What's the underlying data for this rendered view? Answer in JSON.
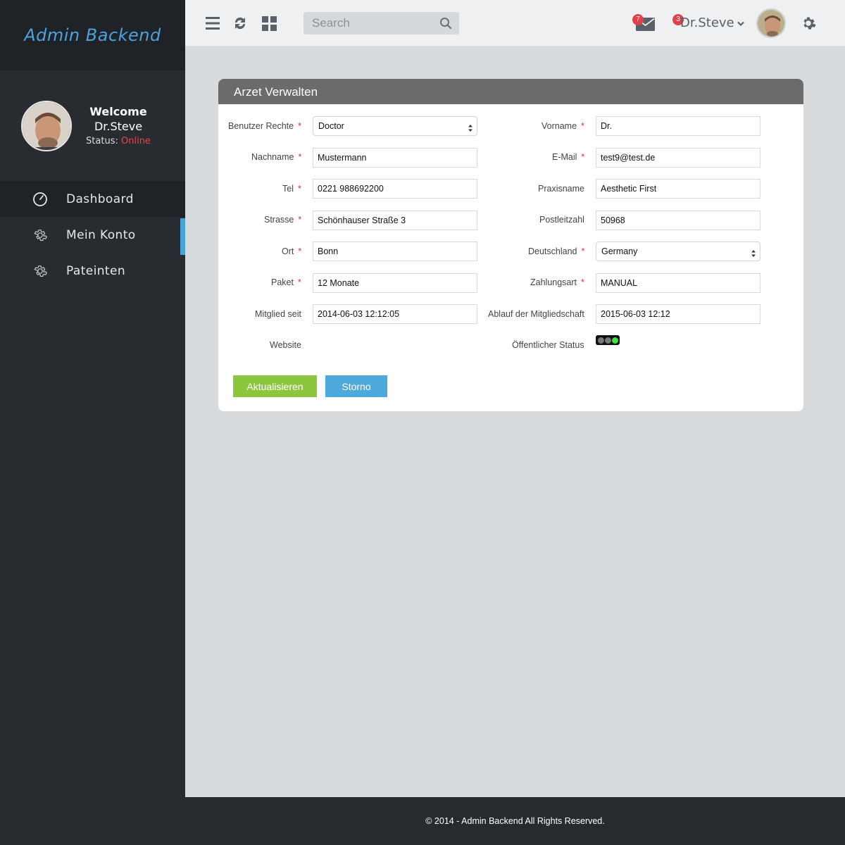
{
  "app": {
    "brand": "Admin Backend"
  },
  "profile": {
    "welcome": "Welcome",
    "name": "Dr.Steve",
    "status_label": "Status:",
    "status_value": "Online"
  },
  "sidebar": {
    "items": [
      {
        "label": "Dashboard",
        "icon": "dashboard-gauge-icon",
        "active": true
      },
      {
        "label": "Mein Konto",
        "icon": "gear-icon"
      },
      {
        "label": "Pateinten",
        "icon": "gear-icon"
      }
    ]
  },
  "topbar": {
    "search_placeholder": "Search",
    "mail_badge": "7",
    "user_badge": "3",
    "user_name": "Dr.Steve",
    "icons": [
      "menu-icon",
      "refresh-icon",
      "grid-icon",
      "search-icon",
      "mail-icon",
      "chevron-down-icon",
      "avatar",
      "gear-icon"
    ]
  },
  "panel": {
    "title": "Arzet Verwalten",
    "left_fields": [
      {
        "label": "Benutzer Rechte",
        "required": "*",
        "value": "Doctor",
        "type": "select"
      },
      {
        "label": "Nachname",
        "required": "*",
        "value": "Mustermann"
      },
      {
        "label": "Tel",
        "required": "*",
        "value": "0221 988692200"
      },
      {
        "label": "Strasse",
        "required": "*",
        "value": "Schönhauser Straße 3"
      },
      {
        "label": "Ort",
        "required": "*",
        "value": "Bonn"
      },
      {
        "label": "Paket",
        "required": "*",
        "value": "12 Monate"
      },
      {
        "label": "Mitglied seit",
        "value": "2014-06-03 12:12:05"
      },
      {
        "label": "Website"
      }
    ],
    "right_fields": [
      {
        "label": "Vorname",
        "required": "*",
        "value": "Dr."
      },
      {
        "label": "E-Mail",
        "required": "*",
        "value": "test9@test.de"
      },
      {
        "label": "Praxisname",
        "value": "Aesthetic First"
      },
      {
        "label": "Postleitzahl",
        "value": "50968"
      },
      {
        "label": "Deutschland",
        "required": "*",
        "value": "Germany",
        "type": "select"
      },
      {
        "label": "Zahlungsart",
        "required": "*",
        "value": "MANUAL"
      },
      {
        "label": "Ablauf der Mitgliedschaft",
        "value": "2015-06-03 12:12"
      },
      {
        "label": "Öffentlicher Status",
        "type": "toggle"
      }
    ],
    "buttons": {
      "update": "Aktualisieren",
      "cancel": "Storno"
    }
  },
  "colors": {
    "accent": "#4aa3dc",
    "update_button": "#8cc63f",
    "cancel_button": "#4ea9dc",
    "badge": "#e0424a",
    "online": "#e04848"
  },
  "footer": {
    "text": "© 2014 - Admin Backend All Rights Reserved."
  }
}
